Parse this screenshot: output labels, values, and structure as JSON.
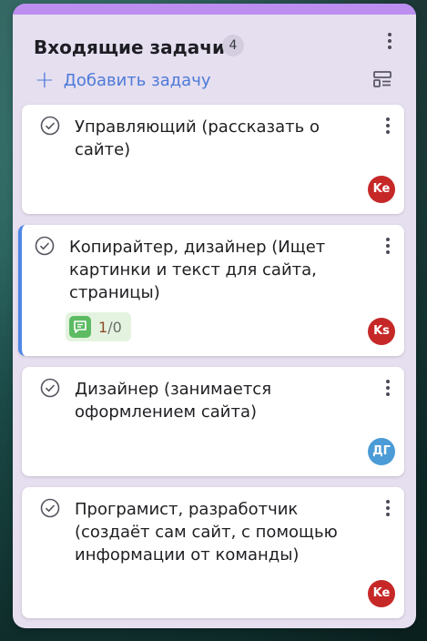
{
  "column": {
    "title": "Входящие задачи",
    "count": "4",
    "add_task_label": "Добавить задачу",
    "colors": {
      "accent_bar": "#bb8ef0",
      "background": "#e6dff0",
      "link": "#4d7ad8"
    }
  },
  "cards": [
    {
      "title": "Управляющий (рассказать о сайте)",
      "avatar_initials": "Ke",
      "avatar_color": "#c62828"
    },
    {
      "title": "Копирайтер, дизайнер (Ищет картинки и текст для сайта, страницы)",
      "comments_done": "1",
      "comments_sep": "/",
      "comments_total": "0",
      "avatar_initials": "Ks",
      "avatar_color": "#c62828",
      "accent_color": "#4f86e8"
    },
    {
      "title": "Дизайнер (занимается оформлением сайта)",
      "avatar_initials": "ДГ",
      "avatar_color": "#4a9bd6"
    },
    {
      "title": "Програмист, разработчик (создаёт сам сайт, с помощью информации от команды)",
      "avatar_initials": "Ke",
      "avatar_color": "#c62828"
    }
  ]
}
